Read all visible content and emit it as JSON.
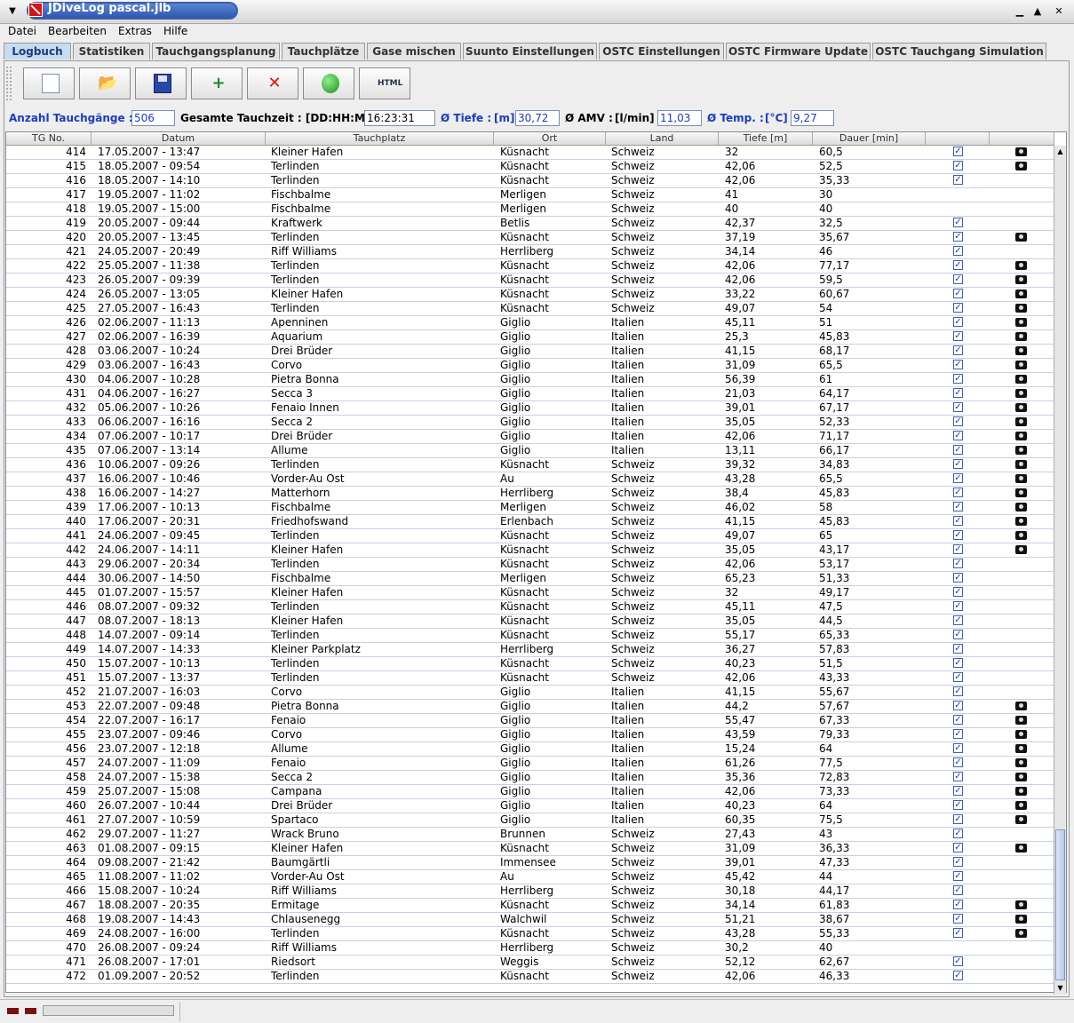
{
  "window": {
    "title": "JDiveLog pascal.jlb"
  },
  "menu": [
    {
      "label": "Datei"
    },
    {
      "label": "Bearbeiten"
    },
    {
      "label": "Extras"
    },
    {
      "label": "Hilfe"
    }
  ],
  "tabs": [
    {
      "label": "Logbuch",
      "active": true
    },
    {
      "label": "Statistiken"
    },
    {
      "label": "Tauchgangsplanung"
    },
    {
      "label": "Tauchplätze"
    },
    {
      "label": "Gase mischen"
    },
    {
      "label": "Suunto Einstellungen"
    },
    {
      "label": "OSTC Einstellungen"
    },
    {
      "label": "OSTC Firmware Update"
    },
    {
      "label": "OSTC Tauchgang Simulation"
    }
  ],
  "toolbar": [
    {
      "icon": "new-file-icon"
    },
    {
      "icon": "open-folder-icon"
    },
    {
      "icon": "save-disk-icon"
    },
    {
      "icon": "add-dive-icon"
    },
    {
      "icon": "delete-dive-icon"
    },
    {
      "icon": "globe-icon"
    },
    {
      "icon": "html-export-icon"
    }
  ],
  "stats": {
    "count_label": "Anzahl Tauchgänge :",
    "count_value": "506",
    "time_label": "Gesamte Tauchzeit : [DD:HH:MM]",
    "time_value": "16:23:31",
    "depth_label": "Ø Tiefe :",
    "depth_unit": "[m]",
    "depth_value": "30,72",
    "amv_label": "Ø AMV :",
    "amv_unit": "[l/min]",
    "amv_value": "11,03",
    "temp_label": "Ø Temp. :",
    "temp_unit": "[°C]",
    "temp_value": "9,27"
  },
  "table": {
    "headers": [
      "TG No.",
      "Datum",
      "Tauchplatz",
      "Ort",
      "Land",
      "Tiefe [m]",
      "Dauer [min]",
      "",
      ""
    ],
    "rows": [
      {
        "no": "414",
        "date": "17.05.2007 - 13:47",
        "site": "Kleiner Hafen",
        "place": "Küsnacht",
        "country": "Schweiz",
        "depth": "32",
        "duration": "60,5",
        "checked": true,
        "photo": true
      },
      {
        "no": "415",
        "date": "18.05.2007 - 09:54",
        "site": "Terlinden",
        "place": "Küsnacht",
        "country": "Schweiz",
        "depth": "42,06",
        "duration": "52,5",
        "checked": true,
        "photo": true
      },
      {
        "no": "416",
        "date": "18.05.2007 - 14:10",
        "site": "Terlinden",
        "place": "Küsnacht",
        "country": "Schweiz",
        "depth": "42,06",
        "duration": "35,33",
        "checked": true,
        "photo": false
      },
      {
        "no": "417",
        "date": "19.05.2007 - 11:02",
        "site": "Fischbalme",
        "place": "Merligen",
        "country": "Schweiz",
        "depth": "41",
        "duration": "30",
        "checked": false,
        "photo": false
      },
      {
        "no": "418",
        "date": "19.05.2007 - 15:00",
        "site": "Fischbalme",
        "place": "Merligen",
        "country": "Schweiz",
        "depth": "40",
        "duration": "40",
        "checked": false,
        "photo": false
      },
      {
        "no": "419",
        "date": "20.05.2007 - 09:44",
        "site": "Kraftwerk",
        "place": "Betlis",
        "country": "Schweiz",
        "depth": "42,37",
        "duration": "32,5",
        "checked": true,
        "photo": false
      },
      {
        "no": "420",
        "date": "20.05.2007 - 13:45",
        "site": "Terlinden",
        "place": "Küsnacht",
        "country": "Schweiz",
        "depth": "37,19",
        "duration": "35,67",
        "checked": true,
        "photo": true
      },
      {
        "no": "421",
        "date": "24.05.2007 - 20:49",
        "site": "Riff Williams",
        "place": "Herrliberg",
        "country": "Schweiz",
        "depth": "34,14",
        "duration": "46",
        "checked": true,
        "photo": false
      },
      {
        "no": "422",
        "date": "25.05.2007 - 11:38",
        "site": "Terlinden",
        "place": "Küsnacht",
        "country": "Schweiz",
        "depth": "42,06",
        "duration": "77,17",
        "checked": true,
        "photo": true
      },
      {
        "no": "423",
        "date": "26.05.2007 - 09:39",
        "site": "Terlinden",
        "place": "Küsnacht",
        "country": "Schweiz",
        "depth": "42,06",
        "duration": "59,5",
        "checked": true,
        "photo": true
      },
      {
        "no": "424",
        "date": "26.05.2007 - 13:05",
        "site": "Kleiner Hafen",
        "place": "Küsnacht",
        "country": "Schweiz",
        "depth": "33,22",
        "duration": "60,67",
        "checked": true,
        "photo": true
      },
      {
        "no": "425",
        "date": "27.05.2007 - 16:43",
        "site": "Terlinden",
        "place": "Küsnacht",
        "country": "Schweiz",
        "depth": "49,07",
        "duration": "54",
        "checked": true,
        "photo": true
      },
      {
        "no": "426",
        "date": "02.06.2007 - 11:13",
        "site": "Apenninen",
        "place": "Giglio",
        "country": "Italien",
        "depth": "45,11",
        "duration": "51",
        "checked": true,
        "photo": true
      },
      {
        "no": "427",
        "date": "02.06.2007 - 16:39",
        "site": "Aquarium",
        "place": "Giglio",
        "country": "Italien",
        "depth": "25,3",
        "duration": "45,83",
        "checked": true,
        "photo": true
      },
      {
        "no": "428",
        "date": "03.06.2007 - 10:24",
        "site": "Drei Brüder",
        "place": "Giglio",
        "country": "Italien",
        "depth": "41,15",
        "duration": "68,17",
        "checked": true,
        "photo": true
      },
      {
        "no": "429",
        "date": "03.06.2007 - 16:43",
        "site": "Corvo",
        "place": "Giglio",
        "country": "Italien",
        "depth": "31,09",
        "duration": "65,5",
        "checked": true,
        "photo": true
      },
      {
        "no": "430",
        "date": "04.06.2007 - 10:28",
        "site": "Pietra Bonna",
        "place": "Giglio",
        "country": "Italien",
        "depth": "56,39",
        "duration": "61",
        "checked": true,
        "photo": true
      },
      {
        "no": "431",
        "date": "04.06.2007 - 16:27",
        "site": "Secca 3",
        "place": "Giglio",
        "country": "Italien",
        "depth": "21,03",
        "duration": "64,17",
        "checked": true,
        "photo": true
      },
      {
        "no": "432",
        "date": "05.06.2007 - 10:26",
        "site": "Fenaio Innen",
        "place": "Giglio",
        "country": "Italien",
        "depth": "39,01",
        "duration": "67,17",
        "checked": true,
        "photo": true
      },
      {
        "no": "433",
        "date": "06.06.2007 - 16:16",
        "site": "Secca 2",
        "place": "Giglio",
        "country": "Italien",
        "depth": "35,05",
        "duration": "52,33",
        "checked": true,
        "photo": true
      },
      {
        "no": "434",
        "date": "07.06.2007 - 10:17",
        "site": "Drei Brüder",
        "place": "Giglio",
        "country": "Italien",
        "depth": "42,06",
        "duration": "71,17",
        "checked": true,
        "photo": true
      },
      {
        "no": "435",
        "date": "07.06.2007 - 13:14",
        "site": "Allume",
        "place": "Giglio",
        "country": "Italien",
        "depth": "13,11",
        "duration": "66,17",
        "checked": true,
        "photo": true
      },
      {
        "no": "436",
        "date": "10.06.2007 - 09:26",
        "site": "Terlinden",
        "place": "Küsnacht",
        "country": "Schweiz",
        "depth": "39,32",
        "duration": "34,83",
        "checked": true,
        "photo": true
      },
      {
        "no": "437",
        "date": "16.06.2007 - 10:46",
        "site": "Vorder-Au Ost",
        "place": "Au",
        "country": "Schweiz",
        "depth": "43,28",
        "duration": "65,5",
        "checked": true,
        "photo": true
      },
      {
        "no": "438",
        "date": "16.06.2007 - 14:27",
        "site": "Matterhorn",
        "place": "Herrliberg",
        "country": "Schweiz",
        "depth": "38,4",
        "duration": "45,83",
        "checked": true,
        "photo": true
      },
      {
        "no": "439",
        "date": "17.06.2007 - 10:13",
        "site": "Fischbalme",
        "place": "Merligen",
        "country": "Schweiz",
        "depth": "46,02",
        "duration": "58",
        "checked": true,
        "photo": true
      },
      {
        "no": "440",
        "date": "17.06.2007 - 20:31",
        "site": "Friedhofswand",
        "place": "Erlenbach",
        "country": "Schweiz",
        "depth": "41,15",
        "duration": "45,83",
        "checked": true,
        "photo": true
      },
      {
        "no": "441",
        "date": "24.06.2007 - 09:45",
        "site": "Terlinden",
        "place": "Küsnacht",
        "country": "Schweiz",
        "depth": "49,07",
        "duration": "65",
        "checked": true,
        "photo": true
      },
      {
        "no": "442",
        "date": "24.06.2007 - 14:11",
        "site": "Kleiner Hafen",
        "place": "Küsnacht",
        "country": "Schweiz",
        "depth": "35,05",
        "duration": "43,17",
        "checked": true,
        "photo": true
      },
      {
        "no": "443",
        "date": "29.06.2007 - 20:34",
        "site": "Terlinden",
        "place": "Küsnacht",
        "country": "Schweiz",
        "depth": "42,06",
        "duration": "53,17",
        "checked": true,
        "photo": false
      },
      {
        "no": "444",
        "date": "30.06.2007 - 14:50",
        "site": "Fischbalme",
        "place": "Merligen",
        "country": "Schweiz",
        "depth": "65,23",
        "duration": "51,33",
        "checked": true,
        "photo": false
      },
      {
        "no": "445",
        "date": "01.07.2007 - 15:57",
        "site": "Kleiner Hafen",
        "place": "Küsnacht",
        "country": "Schweiz",
        "depth": "32",
        "duration": "49,17",
        "checked": true,
        "photo": false
      },
      {
        "no": "446",
        "date": "08.07.2007 - 09:32",
        "site": "Terlinden",
        "place": "Küsnacht",
        "country": "Schweiz",
        "depth": "45,11",
        "duration": "47,5",
        "checked": true,
        "photo": false
      },
      {
        "no": "447",
        "date": "08.07.2007 - 18:13",
        "site": "Kleiner Hafen",
        "place": "Küsnacht",
        "country": "Schweiz",
        "depth": "35,05",
        "duration": "44,5",
        "checked": true,
        "photo": false
      },
      {
        "no": "448",
        "date": "14.07.2007 - 09:14",
        "site": "Terlinden",
        "place": "Küsnacht",
        "country": "Schweiz",
        "depth": "55,17",
        "duration": "65,33",
        "checked": true,
        "photo": false
      },
      {
        "no": "449",
        "date": "14.07.2007 - 14:33",
        "site": "Kleiner Parkplatz",
        "place": "Herrliberg",
        "country": "Schweiz",
        "depth": "36,27",
        "duration": "57,83",
        "checked": true,
        "photo": false
      },
      {
        "no": "450",
        "date": "15.07.2007 - 10:13",
        "site": "Terlinden",
        "place": "Küsnacht",
        "country": "Schweiz",
        "depth": "40,23",
        "duration": "51,5",
        "checked": true,
        "photo": false
      },
      {
        "no": "451",
        "date": "15.07.2007 - 13:37",
        "site": "Terlinden",
        "place": "Küsnacht",
        "country": "Schweiz",
        "depth": "42,06",
        "duration": "43,33",
        "checked": true,
        "photo": false
      },
      {
        "no": "452",
        "date": "21.07.2007 - 16:03",
        "site": "Corvo",
        "place": "Giglio",
        "country": "Italien",
        "depth": "41,15",
        "duration": "55,67",
        "checked": true,
        "photo": false
      },
      {
        "no": "453",
        "date": "22.07.2007 - 09:48",
        "site": "Pietra Bonna",
        "place": "Giglio",
        "country": "Italien",
        "depth": "44,2",
        "duration": "57,67",
        "checked": true,
        "photo": true
      },
      {
        "no": "454",
        "date": "22.07.2007 - 16:17",
        "site": "Fenaio",
        "place": "Giglio",
        "country": "Italien",
        "depth": "55,47",
        "duration": "67,33",
        "checked": true,
        "photo": true
      },
      {
        "no": "455",
        "date": "23.07.2007 - 09:46",
        "site": "Corvo",
        "place": "Giglio",
        "country": "Italien",
        "depth": "43,59",
        "duration": "79,33",
        "checked": true,
        "photo": true
      },
      {
        "no": "456",
        "date": "23.07.2007 - 12:18",
        "site": "Allume",
        "place": "Giglio",
        "country": "Italien",
        "depth": "15,24",
        "duration": "64",
        "checked": true,
        "photo": true
      },
      {
        "no": "457",
        "date": "24.07.2007 - 11:09",
        "site": "Fenaio",
        "place": "Giglio",
        "country": "Italien",
        "depth": "61,26",
        "duration": "77,5",
        "checked": true,
        "photo": true
      },
      {
        "no": "458",
        "date": "24.07.2007 - 15:38",
        "site": "Secca 2",
        "place": "Giglio",
        "country": "Italien",
        "depth": "35,36",
        "duration": "72,83",
        "checked": true,
        "photo": true
      },
      {
        "no": "459",
        "date": "25.07.2007 - 15:08",
        "site": "Campana",
        "place": "Giglio",
        "country": "Italien",
        "depth": "42,06",
        "duration": "73,33",
        "checked": true,
        "photo": true
      },
      {
        "no": "460",
        "date": "26.07.2007 - 10:44",
        "site": "Drei Brüder",
        "place": "Giglio",
        "country": "Italien",
        "depth": "40,23",
        "duration": "64",
        "checked": true,
        "photo": true
      },
      {
        "no": "461",
        "date": "27.07.2007 - 10:59",
        "site": "Spartaco",
        "place": "Giglio",
        "country": "Italien",
        "depth": "60,35",
        "duration": "75,5",
        "checked": true,
        "photo": true
      },
      {
        "no": "462",
        "date": "29.07.2007 - 11:27",
        "site": "Wrack Bruno",
        "place": "Brunnen",
        "country": "Schweiz",
        "depth": "27,43",
        "duration": "43",
        "checked": true,
        "photo": false
      },
      {
        "no": "463",
        "date": "01.08.2007 - 09:15",
        "site": "Kleiner Hafen",
        "place": "Küsnacht",
        "country": "Schweiz",
        "depth": "31,09",
        "duration": "36,33",
        "checked": true,
        "photo": true
      },
      {
        "no": "464",
        "date": "09.08.2007 - 21:42",
        "site": "Baumgärtli",
        "place": "Immensee",
        "country": "Schweiz",
        "depth": "39,01",
        "duration": "47,33",
        "checked": true,
        "photo": false
      },
      {
        "no": "465",
        "date": "11.08.2007 - 11:02",
        "site": "Vorder-Au Ost",
        "place": "Au",
        "country": "Schweiz",
        "depth": "45,42",
        "duration": "44",
        "checked": true,
        "photo": false
      },
      {
        "no": "466",
        "date": "15.08.2007 - 10:24",
        "site": "Riff Williams",
        "place": "Herrliberg",
        "country": "Schweiz",
        "depth": "30,18",
        "duration": "44,17",
        "checked": true,
        "photo": false
      },
      {
        "no": "467",
        "date": "18.08.2007 - 20:35",
        "site": "Ermitage",
        "place": "Küsnacht",
        "country": "Schweiz",
        "depth": "34,14",
        "duration": "61,83",
        "checked": true,
        "photo": true
      },
      {
        "no": "468",
        "date": "19.08.2007 - 14:43",
        "site": "Chlausenegg",
        "place": "Walchwil",
        "country": "Schweiz",
        "depth": "51,21",
        "duration": "38,67",
        "checked": true,
        "photo": true
      },
      {
        "no": "469",
        "date": "24.08.2007 - 16:00",
        "site": "Terlinden",
        "place": "Küsnacht",
        "country": "Schweiz",
        "depth": "43,28",
        "duration": "55,33",
        "checked": true,
        "photo": true
      },
      {
        "no": "470",
        "date": "26.08.2007 - 09:24",
        "site": "Riff Williams",
        "place": "Herrliberg",
        "country": "Schweiz",
        "depth": "30,2",
        "duration": "40",
        "checked": false,
        "photo": false
      },
      {
        "no": "471",
        "date": "26.08.2007 - 17:01",
        "site": "Riedsort",
        "place": "Weggis",
        "country": "Schweiz",
        "depth": "52,12",
        "duration": "62,67",
        "checked": true,
        "photo": false
      },
      {
        "no": "472",
        "date": "01.09.2007 - 20:52",
        "site": "Terlinden",
        "place": "Küsnacht",
        "country": "Schweiz",
        "depth": "42,06",
        "duration": "46,33",
        "checked": true,
        "photo": false
      }
    ]
  }
}
